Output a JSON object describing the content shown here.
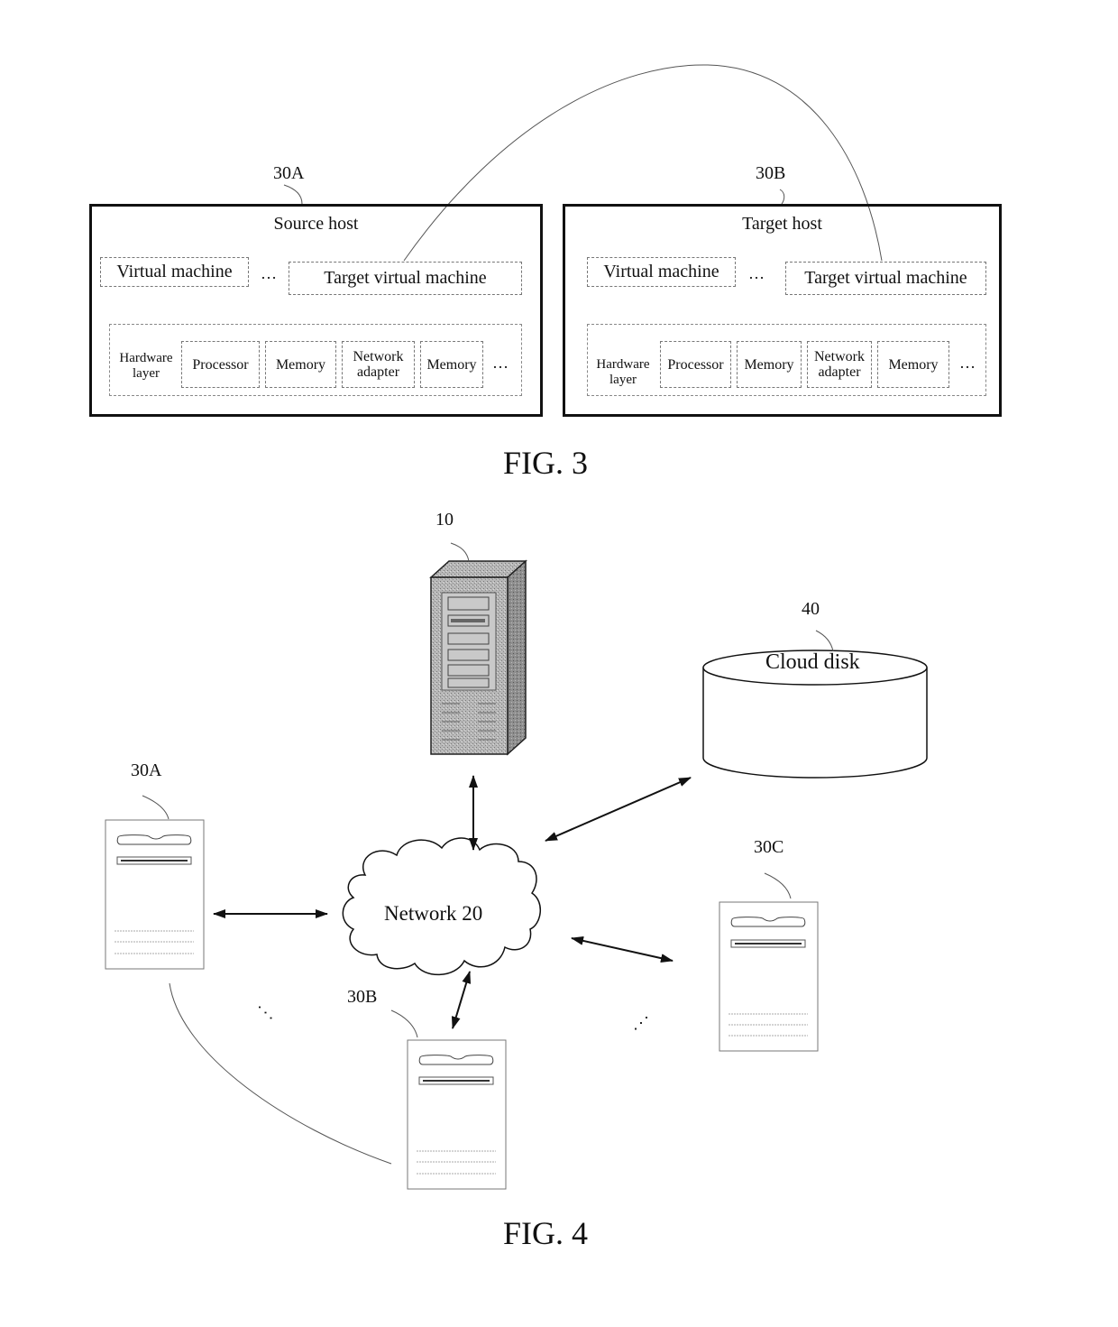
{
  "fig3": {
    "caption": "FIG. 3",
    "source_host": {
      "ref": "30A",
      "title": "Source host",
      "vm": "Virtual machine",
      "ellipsis": "…",
      "target_vm": "Target virtual machine",
      "hardware_label_line1": "Hardware",
      "hardware_label_line2": "layer",
      "components": [
        "Processor",
        "Memory",
        "Network adapter",
        "Memory"
      ],
      "component_lines": {
        "network_line1": "Network",
        "network_line2": "adapter"
      },
      "hw_ellipsis": "…"
    },
    "target_host": {
      "ref": "30B",
      "title": "Target host",
      "vm": "Virtual machine",
      "ellipsis": "…",
      "target_vm": "Target virtual machine",
      "hardware_label_line1": "Hardware",
      "hardware_label_line2": "layer",
      "components": [
        "Processor",
        "Memory",
        "Network adapter",
        "Memory"
      ],
      "component_lines": {
        "network_line1": "Network",
        "network_line2": "adapter"
      },
      "hw_ellipsis": "…"
    }
  },
  "fig4": {
    "caption": "FIG. 4",
    "server": {
      "ref": "10",
      "icon": "server-tower-icon"
    },
    "cloud_disk": {
      "ref": "40",
      "label": "Cloud disk",
      "icon": "database-cylinder-icon"
    },
    "network": {
      "label": "Network 20",
      "icon": "cloud-icon"
    },
    "hosts": [
      {
        "ref": "30A",
        "icon": "host-computer-icon"
      },
      {
        "ref": "30B",
        "icon": "host-computer-icon"
      },
      {
        "ref": "30C",
        "icon": "host-computer-icon"
      }
    ],
    "ellipsis_left": "⋰",
    "ellipsis_right": "⋰"
  }
}
